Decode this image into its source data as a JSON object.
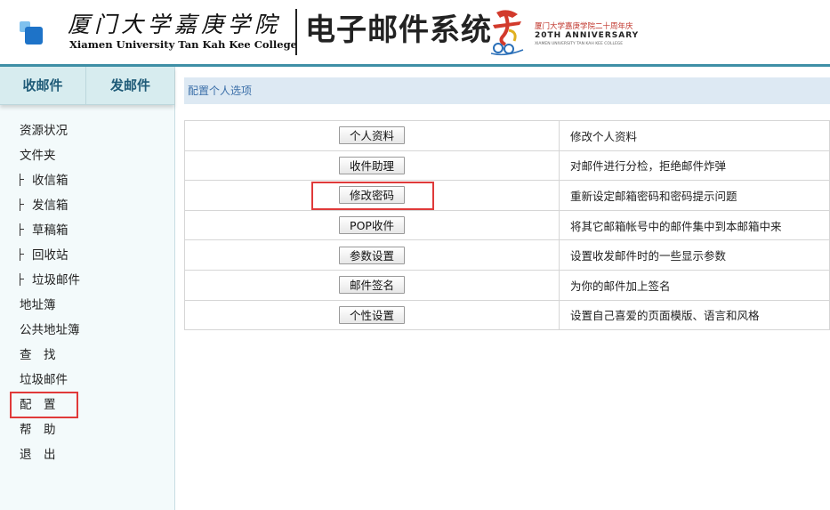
{
  "header": {
    "school_cn": "厦门大学嘉庚学院",
    "school_en": "Xiamen University Tan Kah Kee College",
    "system_title": "电子邮件系统",
    "anniversary_cn": "厦门大学嘉庚学院二十周年庆",
    "anniversary_en": "20TH ANNIVERSARY",
    "anniversary_sub": "XIAMEN UNIVERSITY TAN KAH KEE COLLEGE",
    "brand_color": "#3f8fa6"
  },
  "sidebar": {
    "tabs": [
      {
        "label": "收邮件"
      },
      {
        "label": "发邮件"
      }
    ],
    "items": [
      {
        "label": "资源状况"
      },
      {
        "label": "文件夹"
      },
      {
        "label": "收信箱"
      },
      {
        "label": "发信箱"
      },
      {
        "label": "草稿箱"
      },
      {
        "label": "回收站"
      },
      {
        "label": "垃圾邮件"
      },
      {
        "label": "地址簿"
      },
      {
        "label": "公共地址簿"
      },
      {
        "label": "查　找"
      },
      {
        "label": "垃圾邮件"
      },
      {
        "label": "配　置"
      },
      {
        "label": "帮　助"
      },
      {
        "label": "退　出"
      }
    ]
  },
  "main": {
    "breadcrumb": "配置个人选项",
    "options": [
      {
        "button": "个人资料",
        "desc": "修改个人资料"
      },
      {
        "button": "收件助理",
        "desc": "对邮件进行分检，拒绝邮件炸弹"
      },
      {
        "button": "修改密码",
        "desc": "重新设定邮箱密码和密码提示问题"
      },
      {
        "button": "POP收件",
        "desc": "将其它邮箱帐号中的邮件集中到本邮箱中来"
      },
      {
        "button": "参数设置",
        "desc": "设置收发邮件时的一些显示参数"
      },
      {
        "button": "邮件签名",
        "desc": "为你的邮件加上签名"
      },
      {
        "button": "个性设置",
        "desc": "设置自己喜爱的页面模版、语言和风格"
      }
    ],
    "highlight_color": "#e03a3a"
  }
}
